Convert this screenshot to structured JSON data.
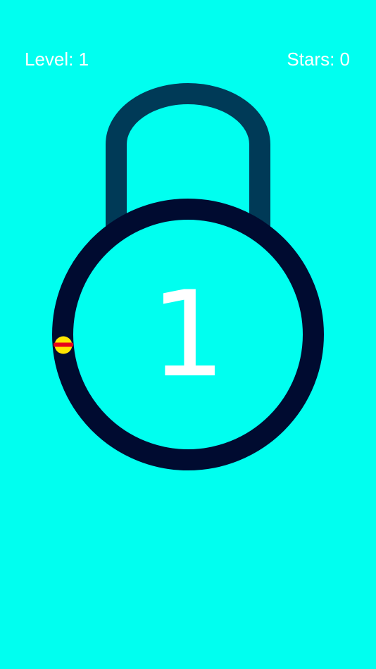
{
  "hud": {
    "level_label": "Level: 1",
    "stars_label": "Stars: 0"
  },
  "lock": {
    "center_number": "1",
    "shackle_color": "#003A57",
    "ring_color": "#000B30",
    "background_color": "#00FFF0"
  },
  "ball": {
    "fill_color": "#FFE600",
    "stripe_color": "#E8001A"
  }
}
